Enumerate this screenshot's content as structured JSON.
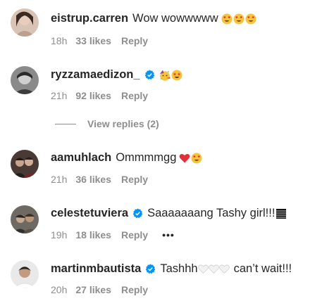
{
  "comments": [
    {
      "username": "eistrup.carren",
      "verified": false,
      "text": "Wow wowwwww",
      "emojis": [
        "heart-eyes",
        "heart-eyes",
        "heart-eyes"
      ],
      "time": "18h",
      "likes": "33 likes",
      "reply": "Reply"
    },
    {
      "username": "ryzzamaedizon_",
      "verified": true,
      "text": "",
      "emojis": [
        "partying-face",
        "star-struck"
      ],
      "time": "21h",
      "likes": "92 likes",
      "reply": "Reply"
    },
    {
      "username": "aamuhlach",
      "verified": false,
      "text": "Ommmmgg",
      "emojis": [
        "red-heart",
        "heart-eyes"
      ],
      "time": "21h",
      "likes": "36 likes",
      "reply": "Reply"
    },
    {
      "username": "celestetuviera",
      "verified": true,
      "text": "Saaaaaaang Tashy girl!!!",
      "emojis": [
        "black-square-icon"
      ],
      "time": "19h",
      "likes": "18 likes",
      "reply": "Reply",
      "more": "•••"
    },
    {
      "username": "martinmbautista",
      "verified": true,
      "text_before": "Tashhh",
      "emojis": [
        "white-heart",
        "white-heart",
        "white-heart"
      ],
      "text_after": "can’t wait!!!",
      "time": "20h",
      "likes": "27 likes",
      "reply": "Reply"
    }
  ],
  "view_replies": {
    "label": "View replies (2)"
  },
  "colors": {
    "text": "#262626",
    "secondary": "#8e8e8e",
    "verified": "#0095f6"
  }
}
